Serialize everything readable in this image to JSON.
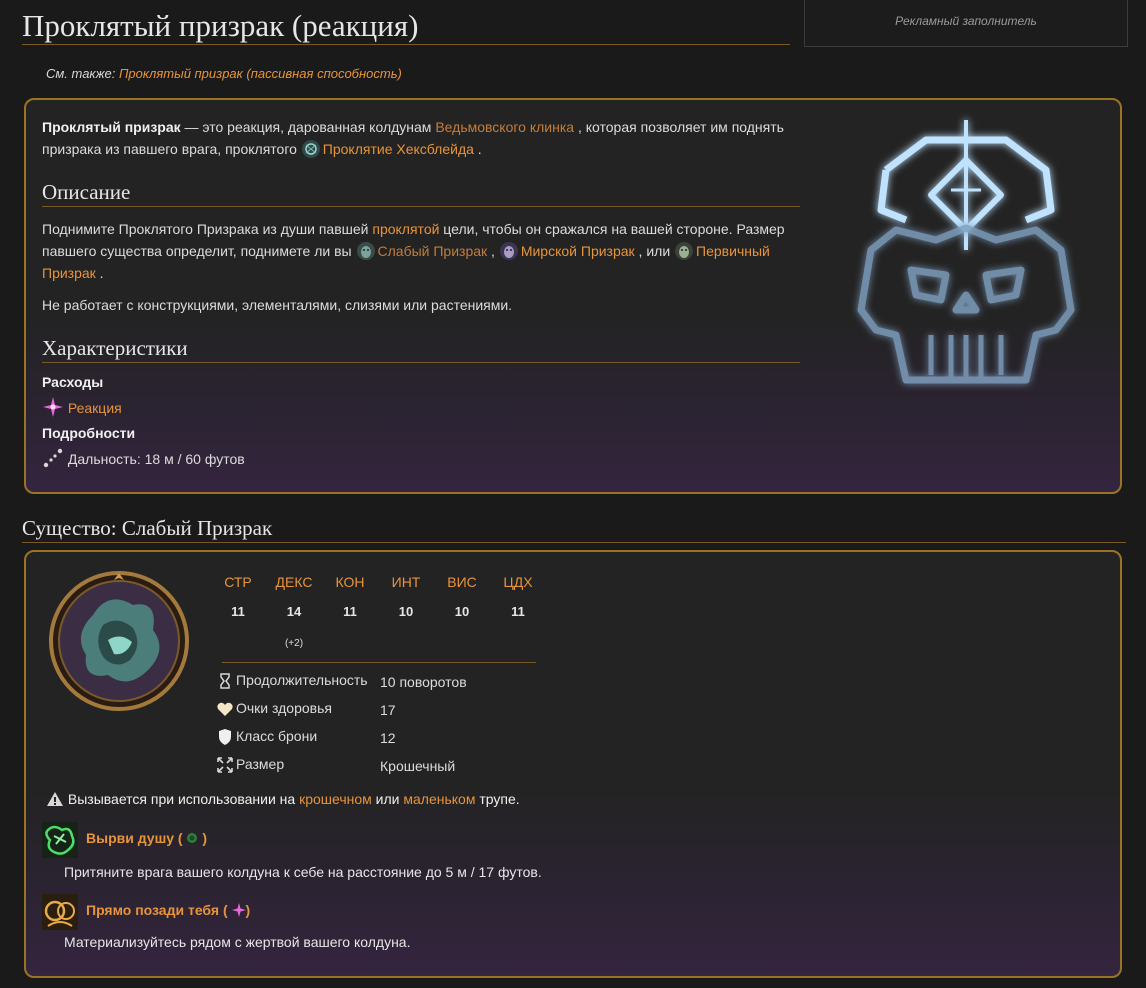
{
  "page": {
    "title": "Проклятый призрак (реакция)",
    "ad_placeholder": "Рекламный заполнитель",
    "see_also_label": "См. также:",
    "see_also_link": "Проклятый призрак (пассивная способность)"
  },
  "main": {
    "intro_bold": "Проклятый призрак",
    "intro_1": " — это реакция, дарованная колдунам ",
    "intro_link_1": "Ведьмовского клинка",
    "intro_2": " , которая позволяет им поднять призрака из павшего врага, проклятого",
    "intro_link_2": "Проклятие Хексблейда",
    "intro_3": " .",
    "description_heading": "Описание",
    "desc_1": "Поднимите Проклятого Призрака из души павшей ",
    "desc_link_cursed": "проклятой",
    "desc_2": " цели, чтобы он сражался на вашей стороне. Размер павшего существа определит, поднимете ли вы",
    "desc_link_weak": "Слабый Призрак",
    "desc_3": " ,",
    "desc_link_mundane": "Мирской Призрак",
    "desc_4": " , или",
    "desc_link_primal": "Первичный Призрак",
    "desc_5": " .",
    "desc_note": "Не работает с конструкциями, элементалями, слизями или растениями.",
    "characteristics_heading": "Характеристики",
    "costs_label": "Расходы",
    "cost_value": "Реакция",
    "details_label": "Подробности",
    "range_value": "Дальность: 18 м / 60 футов"
  },
  "creature": {
    "heading": "Существо: Слабый Призрак",
    "stats": [
      {
        "name": "СТР",
        "value": "11",
        "mod": ""
      },
      {
        "name": "ДЕКС",
        "value": "14",
        "mod": "(+2)"
      },
      {
        "name": "КОН",
        "value": "11",
        "mod": ""
      },
      {
        "name": "ИНТ",
        "value": "10",
        "mod": ""
      },
      {
        "name": "ВИС",
        "value": "10",
        "mod": ""
      },
      {
        "name": "ЦДХ",
        "value": "11",
        "mod": ""
      }
    ],
    "props": [
      {
        "label": "Продолжительность",
        "value": "10 поворотов",
        "icon": "hourglass-icon"
      },
      {
        "label": "Очки здоровья",
        "value": "17",
        "icon": "heart-icon"
      },
      {
        "label": "Класс брони",
        "value": "12",
        "icon": "shield-icon"
      },
      {
        "label": "Размер",
        "value": "Крошечный",
        "icon": "size-icon"
      }
    ],
    "trigger_1": "Вызывается при использовании на ",
    "trigger_link_1": "крошечном",
    "trigger_2": " или ",
    "trigger_link_2": "маленьком",
    "trigger_3": " трупе.",
    "abilities": [
      {
        "title": "Вырви душу",
        "open": " (",
        "close": " )",
        "desc": "Притяните врага вашего колдуна к себе на расстояние до 5 м / 17 футов.",
        "icon": "soul-rip-icon",
        "cost_icon": "action-icon"
      },
      {
        "title": "Прямо позади тебя",
        "open": " (",
        "close": ")",
        "desc": "Материализуйтесь рядом с жертвой вашего колдуна.",
        "icon": "right-behind-you-icon",
        "cost_icon": "reaction-icon"
      }
    ]
  },
  "colors": {
    "accent": "#e8943a",
    "border": "#9b7423",
    "background": "#1a1a1a"
  }
}
